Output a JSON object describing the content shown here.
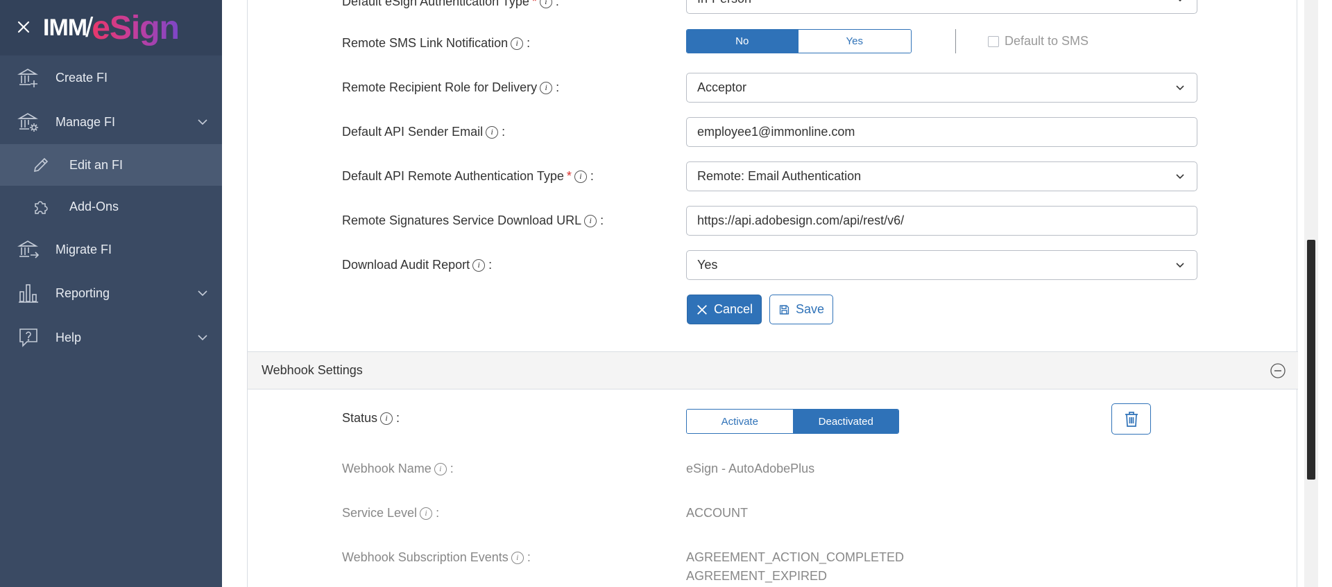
{
  "sidebar": {
    "logo_imm": "IMM",
    "logo_slash": "/",
    "logo_esign": "eSign",
    "items": [
      {
        "label": "Create FI",
        "icon": "bank-add-icon"
      },
      {
        "label": "Manage FI",
        "icon": "bank-settings-icon"
      },
      {
        "label": "Edit an FI",
        "icon": "pencil-icon"
      },
      {
        "label": "Add-Ons",
        "icon": "puzzle-icon"
      },
      {
        "label": "Migrate FI",
        "icon": "bank-transfer-icon"
      },
      {
        "label": "Reporting",
        "icon": "bar-chart-icon"
      },
      {
        "label": "Help",
        "icon": "question-bubble-icon"
      }
    ]
  },
  "form": {
    "auth_type": {
      "label": "Default eSign Authentication Type",
      "value": "In-Person"
    },
    "sms": {
      "label": "Remote SMS Link Notification",
      "no": "No",
      "yes": "Yes",
      "selected": "No",
      "default_to_sms": "Default to SMS"
    },
    "recipient_role": {
      "label": "Remote Recipient Role for Delivery",
      "value": "Acceptor"
    },
    "sender_email": {
      "label": "Default API Sender Email",
      "value": "employee1@immonline.com"
    },
    "remote_auth": {
      "label": "Default API Remote Authentication Type",
      "value": "Remote: Email Authentication"
    },
    "download_url": {
      "label": "Remote Signatures Service Download URL",
      "value": "https://api.adobesign.com/api/rest/v6/"
    },
    "audit_report": {
      "label": "Download Audit Report",
      "value": "Yes"
    },
    "cancel_label": "Cancel",
    "save_label": "Save",
    "colon": ":",
    "required_mark": "*",
    "info_glyph": "i"
  },
  "webhook": {
    "title": "Webhook Settings",
    "status": {
      "label": "Status",
      "activate": "Activate",
      "deactivated": "Deactivated",
      "selected": "Deactivated"
    },
    "name": {
      "label": "Webhook Name",
      "value": "eSign - AutoAdobePlus"
    },
    "service_level": {
      "label": "Service Level",
      "value": "ACCOUNT"
    },
    "events": {
      "label": "Webhook Subscription Events",
      "values": [
        "AGREEMENT_ACTION_COMPLETED",
        "AGREEMENT_EXPIRED"
      ]
    }
  },
  "colors": {
    "sidebar_bg": "#3a4a63",
    "accent": "#2f72b8",
    "required": "#d9302c"
  }
}
